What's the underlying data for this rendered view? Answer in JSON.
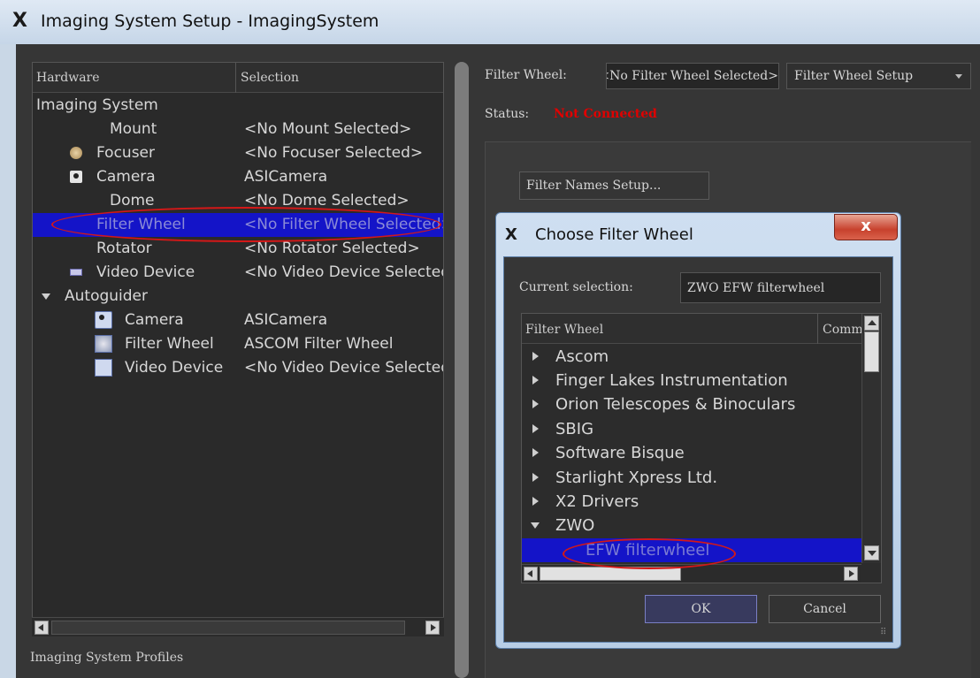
{
  "window": {
    "title": "Imaging System Setup - ImagingSystem",
    "logo": "X"
  },
  "hardware": {
    "headers": {
      "hardware": "Hardware",
      "selection": "Selection"
    },
    "rows": [
      {
        "name": "Imaging System",
        "selection": "",
        "icon": "",
        "level": 0
      },
      {
        "name": "Mount",
        "selection": "<No Mount Selected>",
        "icon": "",
        "level": 1
      },
      {
        "name": "Focuser",
        "selection": "<No Focuser Selected>",
        "icon": "focuser-icon",
        "level": 1
      },
      {
        "name": "Camera",
        "selection": "ASICamera",
        "icon": "camera-icon",
        "level": 1
      },
      {
        "name": "Dome",
        "selection": "<No Dome Selected>",
        "icon": "",
        "level": 1
      },
      {
        "name": "Filter Wheel",
        "selection": "<No Filter Wheel Selected>",
        "icon": "",
        "level": 1,
        "selected": true
      },
      {
        "name": "Rotator",
        "selection": "<No Rotator Selected>",
        "icon": "",
        "level": 1
      },
      {
        "name": "Video Device",
        "selection": "<No Video Device Selected>",
        "icon": "video-icon",
        "level": 1
      },
      {
        "name": "Autoguider",
        "selection": "",
        "icon": "",
        "level": 0,
        "expanded": true
      },
      {
        "name": "Camera",
        "selection": "ASICamera",
        "icon": "camera-icon",
        "level": 2
      },
      {
        "name": "Filter Wheel",
        "selection": "ASCOM Filter Wheel",
        "icon": "filter-wheel-icon",
        "level": 2
      },
      {
        "name": "Video Device",
        "selection": "<No Video Device Selected>",
        "icon": "video-icon",
        "level": 2
      }
    ]
  },
  "profiles_label": "Imaging System Profiles",
  "right": {
    "filter_wheel_label": "Filter Wheel:",
    "filter_wheel_value": "<No Filter Wheel Selected>",
    "setup_dropdown": "Filter Wheel Setup",
    "status_label": "Status:",
    "status_value": "Not Connected",
    "filter_names_button": "Filter Names Setup...",
    "status_color": "#e00000"
  },
  "dialog": {
    "title": "Choose Filter Wheel",
    "close_glyph": "x",
    "current_selection_label": "Current selection:",
    "current_selection_value": "ZWO EFW filterwheel",
    "columns": {
      "filter_wheel": "Filter Wheel",
      "comment": "Comme"
    },
    "items": [
      {
        "label": "Ascom",
        "type": "collapsed"
      },
      {
        "label": "Finger Lakes Instrumentation",
        "type": "collapsed"
      },
      {
        "label": "Orion Telescopes & Binoculars",
        "type": "collapsed"
      },
      {
        "label": "SBIG",
        "type": "collapsed"
      },
      {
        "label": "Software Bisque",
        "type": "collapsed"
      },
      {
        "label": "Starlight Xpress Ltd.",
        "type": "collapsed"
      },
      {
        "label": "X2 Drivers",
        "type": "collapsed"
      },
      {
        "label": "ZWO",
        "type": "expanded"
      },
      {
        "label": "EFW filterwheel",
        "type": "child",
        "selected": true
      }
    ],
    "ok_label": "OK",
    "cancel_label": "Cancel"
  },
  "colors": {
    "selection": "#1414c8",
    "annotation": "#d41818",
    "panel": "#363636"
  }
}
